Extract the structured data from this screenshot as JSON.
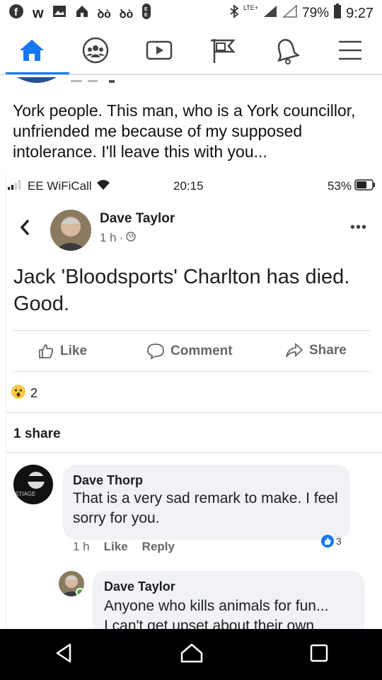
{
  "status_bar": {
    "battery": "79%",
    "time": "9:27",
    "network": "LTE+",
    "icons": [
      "facebook-icon",
      "w-icon",
      "gallery-icon",
      "home-app-icon",
      "app-icon",
      "app-icon",
      "mail-icon",
      "bluetooth-icon",
      "signal-icon",
      "battery-icon"
    ]
  },
  "fb_nav": {
    "icons": [
      "home-icon",
      "groups-icon",
      "watch-icon",
      "pages-icon",
      "bell-icon",
      "menu-icon"
    ],
    "accent": "#1877f2"
  },
  "intro_text": "York people. This man, who is a York councillor, unfriended me because of my supposed intolerance. I'll leave this with you...",
  "embedded": {
    "status": {
      "carrier": "EE WiFiCall",
      "time": "20:15",
      "battery": "53%"
    },
    "post": {
      "author": "Dave Taylor",
      "time": "1 h",
      "dot": "·",
      "text": "Jack 'Bloodsports' Charlton has died. Good.",
      "actions": {
        "like": "Like",
        "comment": "Comment",
        "share": "Share"
      },
      "reaction_count": "2",
      "shares": "1 share"
    },
    "comments": [
      {
        "author": "Dave Thorp",
        "text": "That is a very sad remark to make. I feel sorry for you.",
        "time": "1 h",
        "like": "Like",
        "reply": "Reply",
        "likes": "3"
      },
      {
        "author": "Dave Taylor",
        "text": "Anyone who kills animals for fun...",
        "text2": "I can't get upset about their own"
      }
    ]
  }
}
